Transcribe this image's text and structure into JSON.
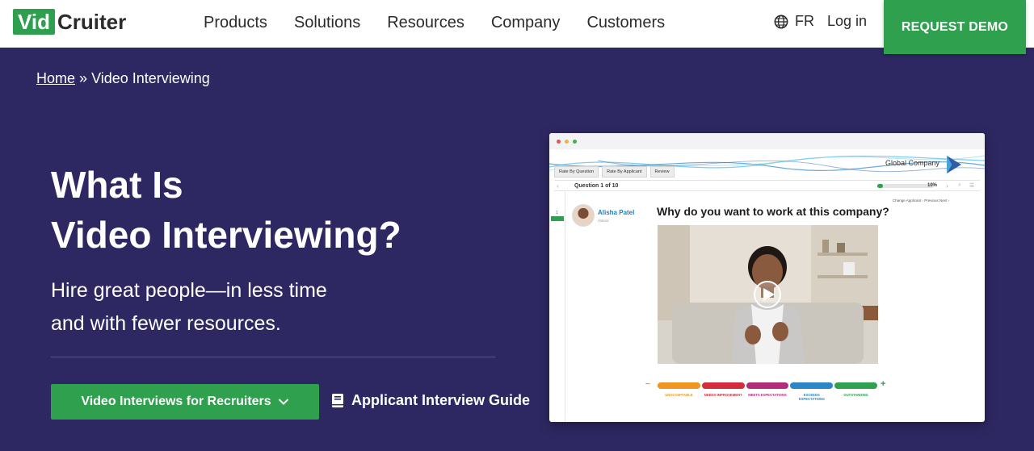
{
  "header": {
    "logo_box": "Vid",
    "logo_rest": "Cruiter",
    "nav": [
      "Products",
      "Solutions",
      "Resources",
      "Company",
      "Customers"
    ],
    "lang": "FR",
    "login": "Log in",
    "demo": "REQUEST DEMO",
    "colors": {
      "brand_green": "#2fa04e"
    }
  },
  "breadcrumb": {
    "home": "Home",
    "sep": "»",
    "current": "Video Interviewing"
  },
  "hero": {
    "title_line1": "What Is",
    "title_line2": "Video Interviewing?",
    "sub_line1": "Hire great people—in less time",
    "sub_line2": "and with fewer resources.",
    "cta_label": "Video Interviews for Recruiters",
    "guide_label": "Applicant Interview Guide",
    "background": "#2e2862"
  },
  "mockup": {
    "company": "Global Company",
    "tabs": [
      "Rate By Question",
      "Rate By Applicant",
      "Review"
    ],
    "question_label": "Question 1 of 10",
    "progress_percent": 10,
    "progress_text": "10%",
    "change_applicant": "Change Applicant  ‹ Previous   Next ›",
    "side_num": "1",
    "candidate_name": "Alisha Patel",
    "candidate_sub": "Videos",
    "question": "Why do you want to work at this company?",
    "ratings": [
      {
        "label": "UNACCEPTABLE",
        "color": "#f0951f"
      },
      {
        "label": "NEEDS IMPROVEMENT",
        "color": "#d42e3b"
      },
      {
        "label": "MEETS EXPECTATIONS",
        "color": "#b22d7a"
      },
      {
        "label": "EXCEEDS EXPECTATIONS",
        "color": "#2a86c9"
      },
      {
        "label": "OUTSTANDING",
        "color": "#2fa04e"
      }
    ],
    "minus": "−",
    "plus": "+"
  }
}
